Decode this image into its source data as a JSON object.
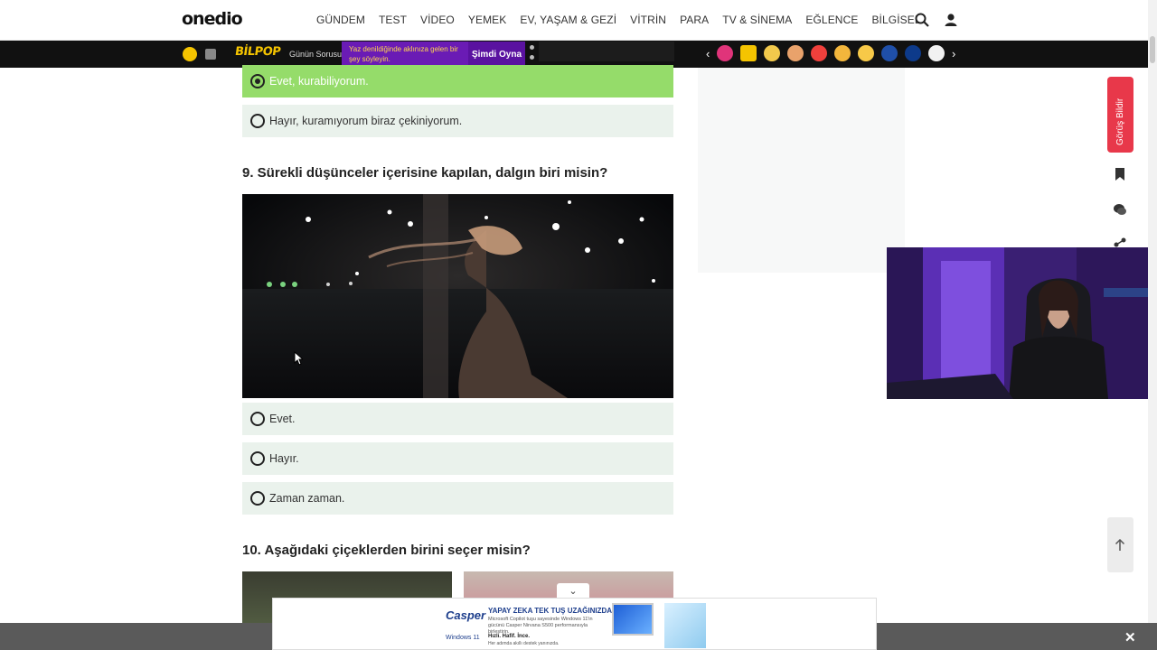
{
  "header": {
    "logo": "onedio",
    "nav": [
      "GÜNDEM",
      "TEST",
      "VİDEO",
      "YEMEK",
      "EV, YAŞAM & GEZİ",
      "VİTRİN",
      "PARA",
      "TV & SİNEMA",
      "EĞLENCE",
      "BİLGİSEL"
    ]
  },
  "topbar": {
    "bilpop": "BİLPOP",
    "gunun": "Günün Sorusu",
    "promo": "Yaz denildiğinde aklınıza gelen bir şey söyleyin.",
    "play": "Şimdi Oyna"
  },
  "quiz": {
    "prev_options": [
      {
        "label": "Evet, kurabiliyorum.",
        "selected": true
      },
      {
        "label": "Hayır, kuramıyorum biraz çekiniyorum.",
        "selected": false
      }
    ],
    "q9": {
      "title": "9. Sürekli düşünceler içerisine kapılan, dalgın biri misin?",
      "options": [
        "Evet.",
        "Hayır.",
        "Zaman zaman."
      ]
    },
    "q10": {
      "title": "10. Aşağıdaki çiçeklerden birini seçer misin?"
    }
  },
  "sidebar": {
    "feedback": "Görüş Bildir"
  },
  "ad": {
    "brand": "Casper",
    "headline": "YAPAY ZEKA TEK TUŞ UZAĞINIZDA",
    "body": "Microsoft Copilot tuşu sayesinde Windows 11'in gücünü Casper Nirvana S500 performansıyla birleştirin.",
    "tagline": "Hızlı. Hafif. İnce.",
    "sub": "Her adımda akıllı destek yanınızda.",
    "os": "Windows 11",
    "collapse": "⌄",
    "close": "✕"
  }
}
